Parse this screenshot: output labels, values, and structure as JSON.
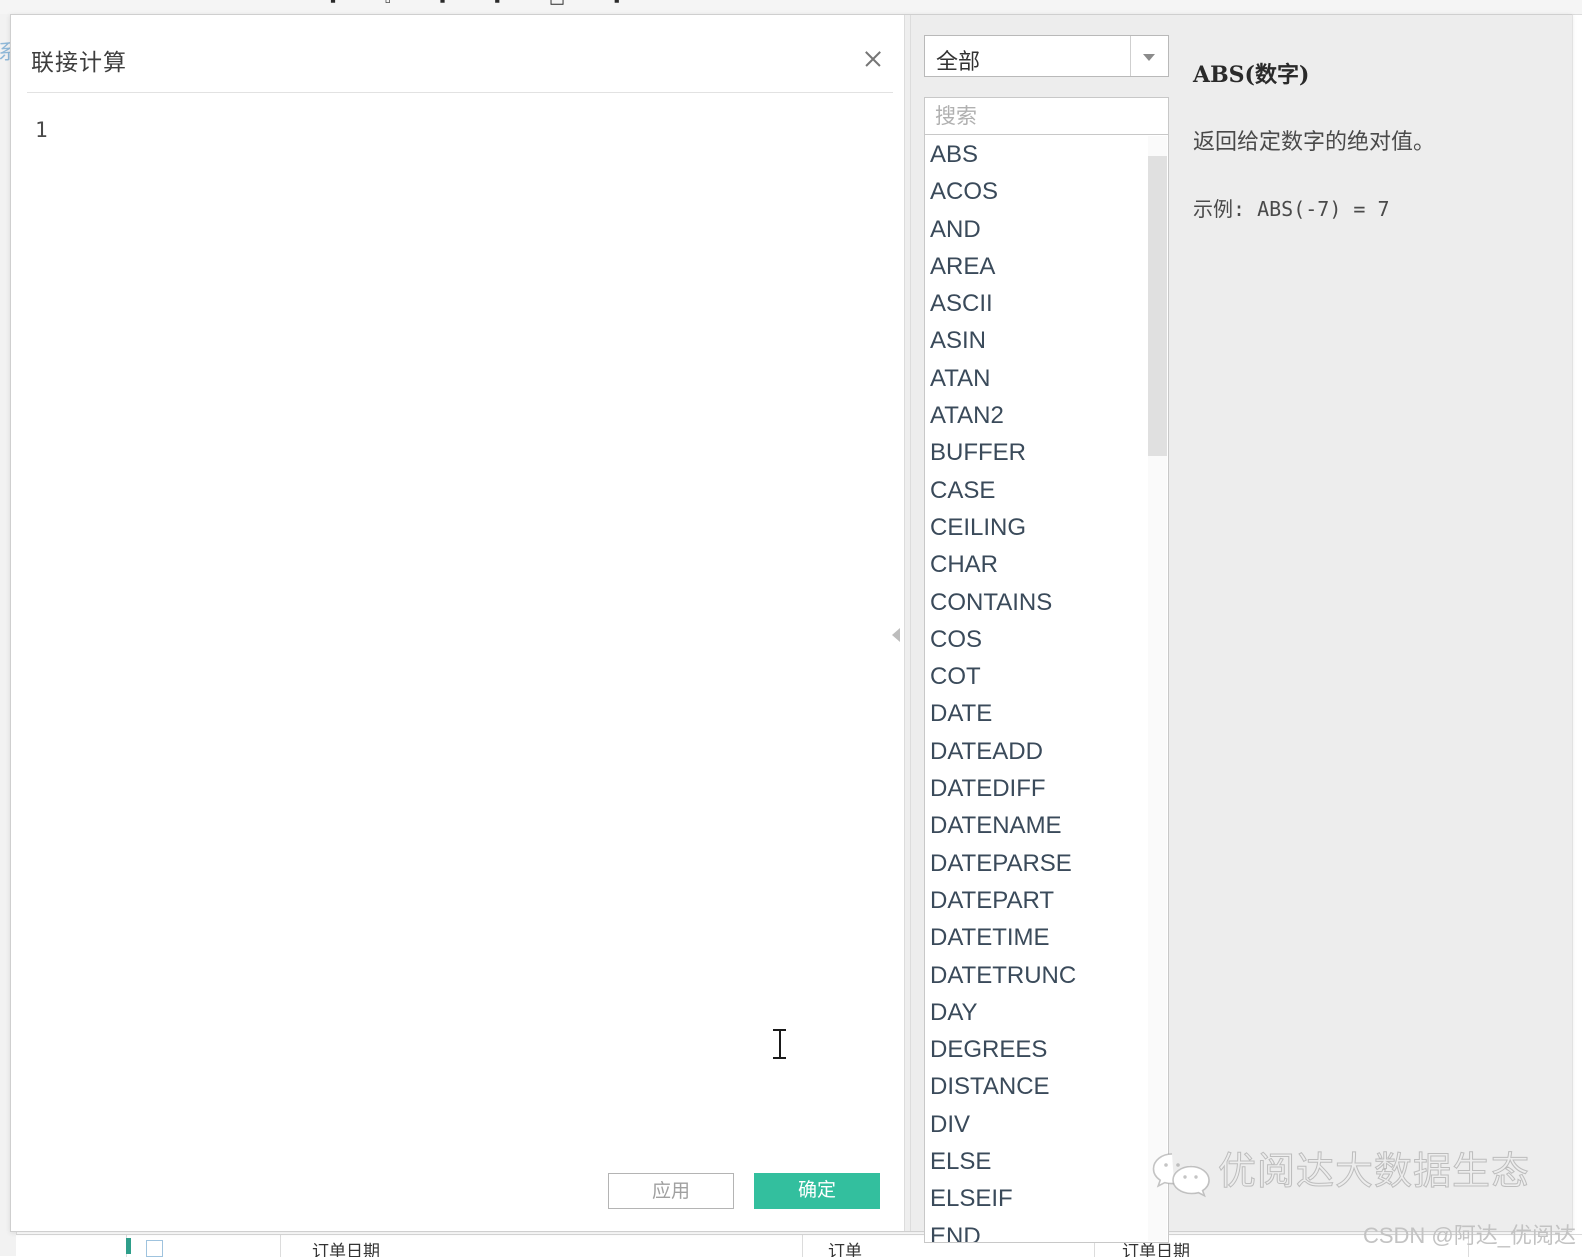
{
  "background": {
    "toolbar_glyphs": "▪ ▫ ▪ ▪ ▭ ▪",
    "left_rail_glyph": "系",
    "grid_headers": [
      "订单日期",
      "订单",
      "订单日期"
    ]
  },
  "dialog": {
    "title": "联接计算",
    "close_icon": "close-icon",
    "collapse_icon": "triangle-left-icon",
    "editor": {
      "line_number": "1",
      "code": ""
    },
    "footer": {
      "apply_label": "应用",
      "ok_label": "确定",
      "ok_color": "#33bf9e"
    }
  },
  "reference": {
    "category": {
      "selected": "全部",
      "caret_icon": "chevron-down-icon"
    },
    "search": {
      "value": "",
      "placeholder": "搜索"
    },
    "functions": [
      "ABS",
      "ACOS",
      "AND",
      "AREA",
      "ASCII",
      "ASIN",
      "ATAN",
      "ATAN2",
      "BUFFER",
      "CASE",
      "CEILING",
      "CHAR",
      "CONTAINS",
      "COS",
      "COT",
      "DATE",
      "DATEADD",
      "DATEDIFF",
      "DATENAME",
      "DATEPARSE",
      "DATEPART",
      "DATETIME",
      "DATETRUNC",
      "DAY",
      "DEGREES",
      "DISTANCE",
      "DIV",
      "ELSE",
      "ELSEIF",
      "END"
    ],
    "help": {
      "signature": "ABS(数字)",
      "description": "返回给定数字的绝对值。",
      "example": "示例: ABS(-7) = 7"
    }
  },
  "watermark": {
    "icon": "wechat-icon",
    "account": "优阅达大数据生态",
    "credit": "CSDN @阿达_优阅达"
  }
}
